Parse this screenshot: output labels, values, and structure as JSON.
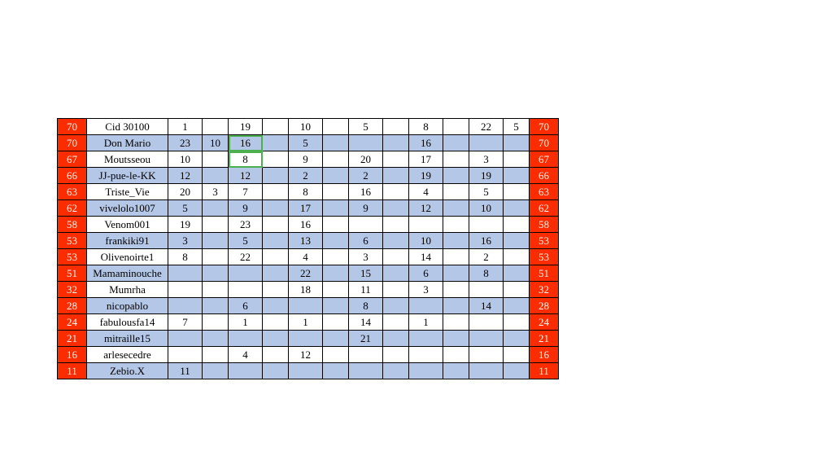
{
  "chart_data": {
    "type": "table",
    "columns": [
      "score_left",
      "name",
      "v1",
      "v2",
      "v3",
      "v4",
      "v5",
      "v6",
      "v7",
      "v8",
      "v9",
      "v10",
      "v11",
      "v12",
      "score_right"
    ],
    "rows": [
      {
        "score_left": "70",
        "name": "Cid 30100",
        "v1": "1",
        "v2": "",
        "v3": "19",
        "v4": "",
        "v5": "10",
        "v6": "",
        "v7": "5",
        "v8": "",
        "v9": "8",
        "v10": "",
        "v11": "22",
        "v12": "5",
        "score_right": "70",
        "shade": false,
        "hl": null
      },
      {
        "score_left": "70",
        "name": "Don Mario",
        "v1": "23",
        "v2": "10",
        "v3": "16",
        "v4": "",
        "v5": "5",
        "v6": "",
        "v7": "",
        "v8": "",
        "v9": "16",
        "v10": "",
        "v11": "",
        "v12": "",
        "score_right": "70",
        "shade": true,
        "hl": "v3"
      },
      {
        "score_left": "67",
        "name": "Moutsseou",
        "v1": "10",
        "v2": "",
        "v3": "8",
        "v4": "",
        "v5": "9",
        "v6": "",
        "v7": "20",
        "v8": "",
        "v9": "17",
        "v10": "",
        "v11": "3",
        "v12": "",
        "score_right": "67",
        "shade": false,
        "hl": "v3"
      },
      {
        "score_left": "66",
        "name": "JJ-pue-le-KK",
        "v1": "12",
        "v2": "",
        "v3": "12",
        "v4": "",
        "v5": "2",
        "v6": "",
        "v7": "2",
        "v8": "",
        "v9": "19",
        "v10": "",
        "v11": "19",
        "v12": "",
        "score_right": "66",
        "shade": true,
        "hl": null
      },
      {
        "score_left": "63",
        "name": "Triste_Vie",
        "v1": "20",
        "v2": "3",
        "v3": "7",
        "v4": "",
        "v5": "8",
        "v6": "",
        "v7": "16",
        "v8": "",
        "v9": "4",
        "v10": "",
        "v11": "5",
        "v12": "",
        "score_right": "63",
        "shade": false,
        "hl": null
      },
      {
        "score_left": "62",
        "name": "vivelolo1007",
        "v1": "5",
        "v2": "",
        "v3": "9",
        "v4": "",
        "v5": "17",
        "v6": "",
        "v7": "9",
        "v8": "",
        "v9": "12",
        "v10": "",
        "v11": "10",
        "v12": "",
        "score_right": "62",
        "shade": true,
        "hl": null
      },
      {
        "score_left": "58",
        "name": "Venom001",
        "v1": "19",
        "v2": "",
        "v3": "23",
        "v4": "",
        "v5": "16",
        "v6": "",
        "v7": "",
        "v8": "",
        "v9": "",
        "v10": "",
        "v11": "",
        "v12": "",
        "score_right": "58",
        "shade": false,
        "hl": null
      },
      {
        "score_left": "53",
        "name": "frankiki91",
        "v1": "3",
        "v2": "",
        "v3": "5",
        "v4": "",
        "v5": "13",
        "v6": "",
        "v7": "6",
        "v8": "",
        "v9": "10",
        "v10": "",
        "v11": "16",
        "v12": "",
        "score_right": "53",
        "shade": true,
        "hl": null
      },
      {
        "score_left": "53",
        "name": "Olivenoirte1",
        "v1": "8",
        "v2": "",
        "v3": "22",
        "v4": "",
        "v5": "4",
        "v6": "",
        "v7": "3",
        "v8": "",
        "v9": "14",
        "v10": "",
        "v11": "2",
        "v12": "",
        "score_right": "53",
        "shade": false,
        "hl": null
      },
      {
        "score_left": "51",
        "name": "Mamaminouche",
        "v1": "",
        "v2": "",
        "v3": "",
        "v4": "",
        "v5": "22",
        "v6": "",
        "v7": "15",
        "v8": "",
        "v9": "6",
        "v10": "",
        "v11": "8",
        "v12": "",
        "score_right": "51",
        "shade": true,
        "hl": null
      },
      {
        "score_left": "32",
        "name": "Mumrha",
        "v1": "",
        "v2": "",
        "v3": "",
        "v4": "",
        "v5": "18",
        "v6": "",
        "v7": "11",
        "v8": "",
        "v9": "3",
        "v10": "",
        "v11": "",
        "v12": "",
        "score_right": "32",
        "shade": false,
        "hl": null
      },
      {
        "score_left": "28",
        "name": "nicopablo",
        "v1": "",
        "v2": "",
        "v3": "6",
        "v4": "",
        "v5": "",
        "v6": "",
        "v7": "8",
        "v8": "",
        "v9": "",
        "v10": "",
        "v11": "14",
        "v12": "",
        "score_right": "28",
        "shade": true,
        "hl": null
      },
      {
        "score_left": "24",
        "name": "fabulousfa14",
        "v1": "7",
        "v2": "",
        "v3": "1",
        "v4": "",
        "v5": "1",
        "v6": "",
        "v7": "14",
        "v8": "",
        "v9": "1",
        "v10": "",
        "v11": "",
        "v12": "",
        "score_right": "24",
        "shade": false,
        "hl": null
      },
      {
        "score_left": "21",
        "name": "mitraille15",
        "v1": "",
        "v2": "",
        "v3": "",
        "v4": "",
        "v5": "",
        "v6": "",
        "v7": "21",
        "v8": "",
        "v9": "",
        "v10": "",
        "v11": "",
        "v12": "",
        "score_right": "21",
        "shade": true,
        "hl": null
      },
      {
        "score_left": "16",
        "name": "arlesecedre",
        "v1": "",
        "v2": "",
        "v3": "4",
        "v4": "",
        "v5": "12",
        "v6": "",
        "v7": "",
        "v8": "",
        "v9": "",
        "v10": "",
        "v11": "",
        "v12": "",
        "score_right": "16",
        "shade": false,
        "hl": null
      },
      {
        "score_left": "11",
        "name": "Zebio.X",
        "v1": "11",
        "v2": "",
        "v3": "",
        "v4": "",
        "v5": "",
        "v6": "",
        "v7": "",
        "v8": "",
        "v9": "",
        "v10": "",
        "v11": "",
        "v12": "",
        "score_right": "11",
        "shade": true,
        "hl": null
      }
    ]
  }
}
